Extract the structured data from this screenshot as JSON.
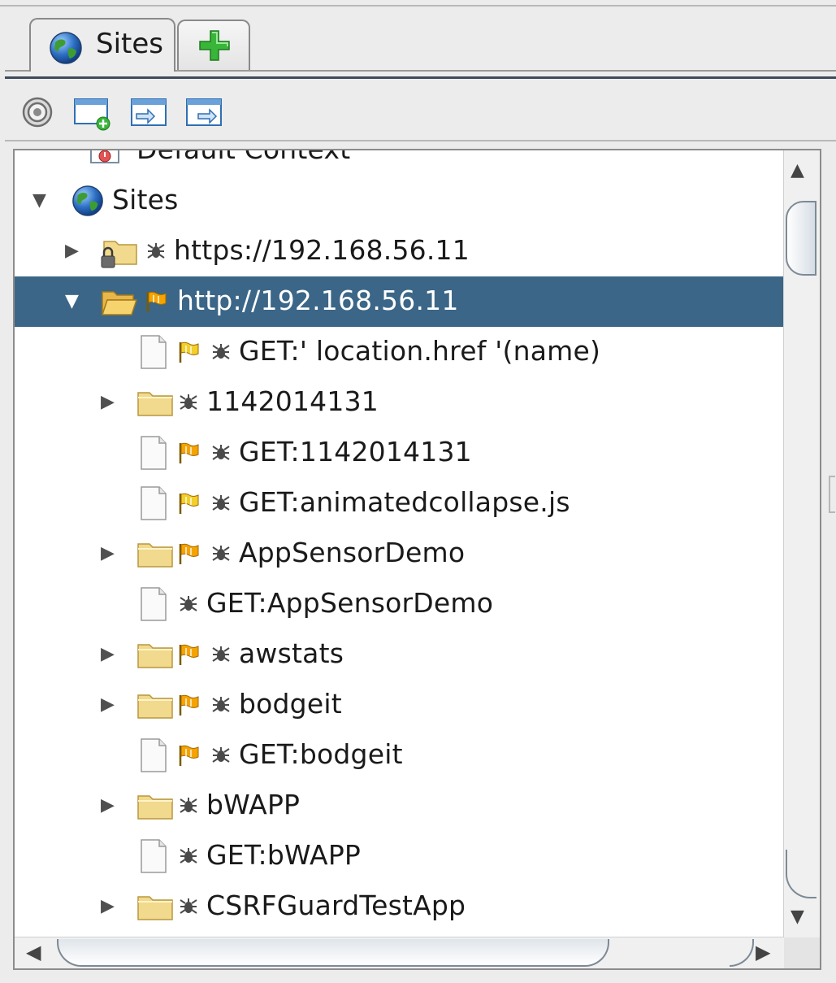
{
  "tabs": [
    {
      "label": "Sites",
      "icon": "globe-icon"
    },
    {
      "label": "",
      "icon": "plus-icon"
    }
  ],
  "toolbar": {
    "buttons": [
      "target-icon",
      "new-context-icon",
      "import-context-icon",
      "export-context-icon"
    ]
  },
  "tree": {
    "clipped_top_label": "Default Context",
    "rows": [
      {
        "label": "Sites",
        "level": 0,
        "expander": "expanded",
        "icon": "globe-icon",
        "flag": "none",
        "spider": false
      },
      {
        "label": "https://192.168.56.11",
        "level": 1,
        "expander": "collapsed",
        "icon": "locked-folder-icon",
        "flag": "none",
        "spider": true
      },
      {
        "label": "http://192.168.56.11",
        "level": 1,
        "expander": "expanded",
        "icon": "open-folder-icon",
        "flag": "orange",
        "spider": false,
        "selected": true
      },
      {
        "label": "GET:' location.href '(name)",
        "level": 2,
        "expander": "none",
        "icon": "file-icon",
        "flag": "yellow",
        "spider": true
      },
      {
        "label": "1142014131",
        "level": 2,
        "expander": "collapsed",
        "icon": "folder-icon",
        "flag": "none",
        "spider": true
      },
      {
        "label": "GET:1142014131",
        "level": 2,
        "expander": "none",
        "icon": "file-icon",
        "flag": "orange",
        "spider": true
      },
      {
        "label": "GET:animatedcollapse.js",
        "level": 2,
        "expander": "none",
        "icon": "file-icon",
        "flag": "yellow",
        "spider": true
      },
      {
        "label": "AppSensorDemo",
        "level": 2,
        "expander": "collapsed",
        "icon": "folder-icon",
        "flag": "orange",
        "spider": true
      },
      {
        "label": "GET:AppSensorDemo",
        "level": 2,
        "expander": "none",
        "icon": "file-icon",
        "flag": "none",
        "spider": true
      },
      {
        "label": "awstats",
        "level": 2,
        "expander": "collapsed",
        "icon": "folder-icon",
        "flag": "orange",
        "spider": true
      },
      {
        "label": "bodgeit",
        "level": 2,
        "expander": "collapsed",
        "icon": "folder-icon",
        "flag": "orange",
        "spider": true
      },
      {
        "label": "GET:bodgeit",
        "level": 2,
        "expander": "none",
        "icon": "file-icon",
        "flag": "orange",
        "spider": true
      },
      {
        "label": "bWAPP",
        "level": 2,
        "expander": "collapsed",
        "icon": "folder-icon",
        "flag": "none",
        "spider": true
      },
      {
        "label": "GET:bWAPP",
        "level": 2,
        "expander": "none",
        "icon": "file-icon",
        "flag": "none",
        "spider": true
      },
      {
        "label": "CSRFGuardTestApp",
        "level": 2,
        "expander": "collapsed",
        "icon": "folder-icon",
        "flag": "none",
        "spider": true
      }
    ]
  },
  "colors": {
    "selection": "#3b6687",
    "flag_orange": "#f5a300",
    "flag_yellow": "#f2cf2a",
    "folder": "#f1d98d",
    "add_green": "#39b539"
  }
}
